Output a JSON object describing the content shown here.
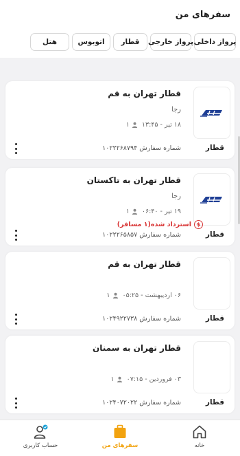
{
  "header": {
    "title": "سفرهای من",
    "tabs": [
      "پرواز داخلی",
      "پرواز خارجی",
      "قطار",
      "اتوبوس",
      "هتل"
    ]
  },
  "cards": [
    {
      "title": "قطار تهران به قم",
      "company": "رجا",
      "date": "۱۸ تیر - ۱۳:۴۵",
      "passengers": "۱",
      "order": "شماره سفارش ۱۰۲۲۲۶۸۷۹۴",
      "type": "قطار",
      "logo": "raja-train-logo"
    },
    {
      "title": "قطار تهران به تاکستان",
      "company": "رجا",
      "date": "۱۹ تیر - ۰۶:۴۰",
      "passengers": "۱",
      "refund": "استرداد شده(۱ مسافر)",
      "order": "شماره سفارش ۱۰۲۲۲۶۵۸۵۷",
      "type": "قطار",
      "logo": "raja-train-logo"
    },
    {
      "title": "قطار تهران به قم",
      "company": "",
      "date": "۰۶ اردیبهشت - ۰۵:۲۵",
      "passengers": "۱",
      "order": "شماره سفارش ۱۰۲۴۹۲۲۷۳۸",
      "type": "قطار",
      "logo": ""
    },
    {
      "title": "قطار تهران به سمنان",
      "company": "",
      "date": "۰۳ فروردین - ۰۷:۱۵",
      "passengers": "۱",
      "order": "شماره سفارش ۱۰۲۴۰۷۲۰۲۲",
      "type": "قطار",
      "logo": ""
    }
  ],
  "nav": {
    "home": "خانه",
    "trips": "سفرهای من",
    "account": "حساب کاربری"
  },
  "colors": {
    "accent": "#f2a30f",
    "refund": "#d83535",
    "logo_blue": "#1f3f95",
    "account_badge": "#1fa3d8"
  }
}
